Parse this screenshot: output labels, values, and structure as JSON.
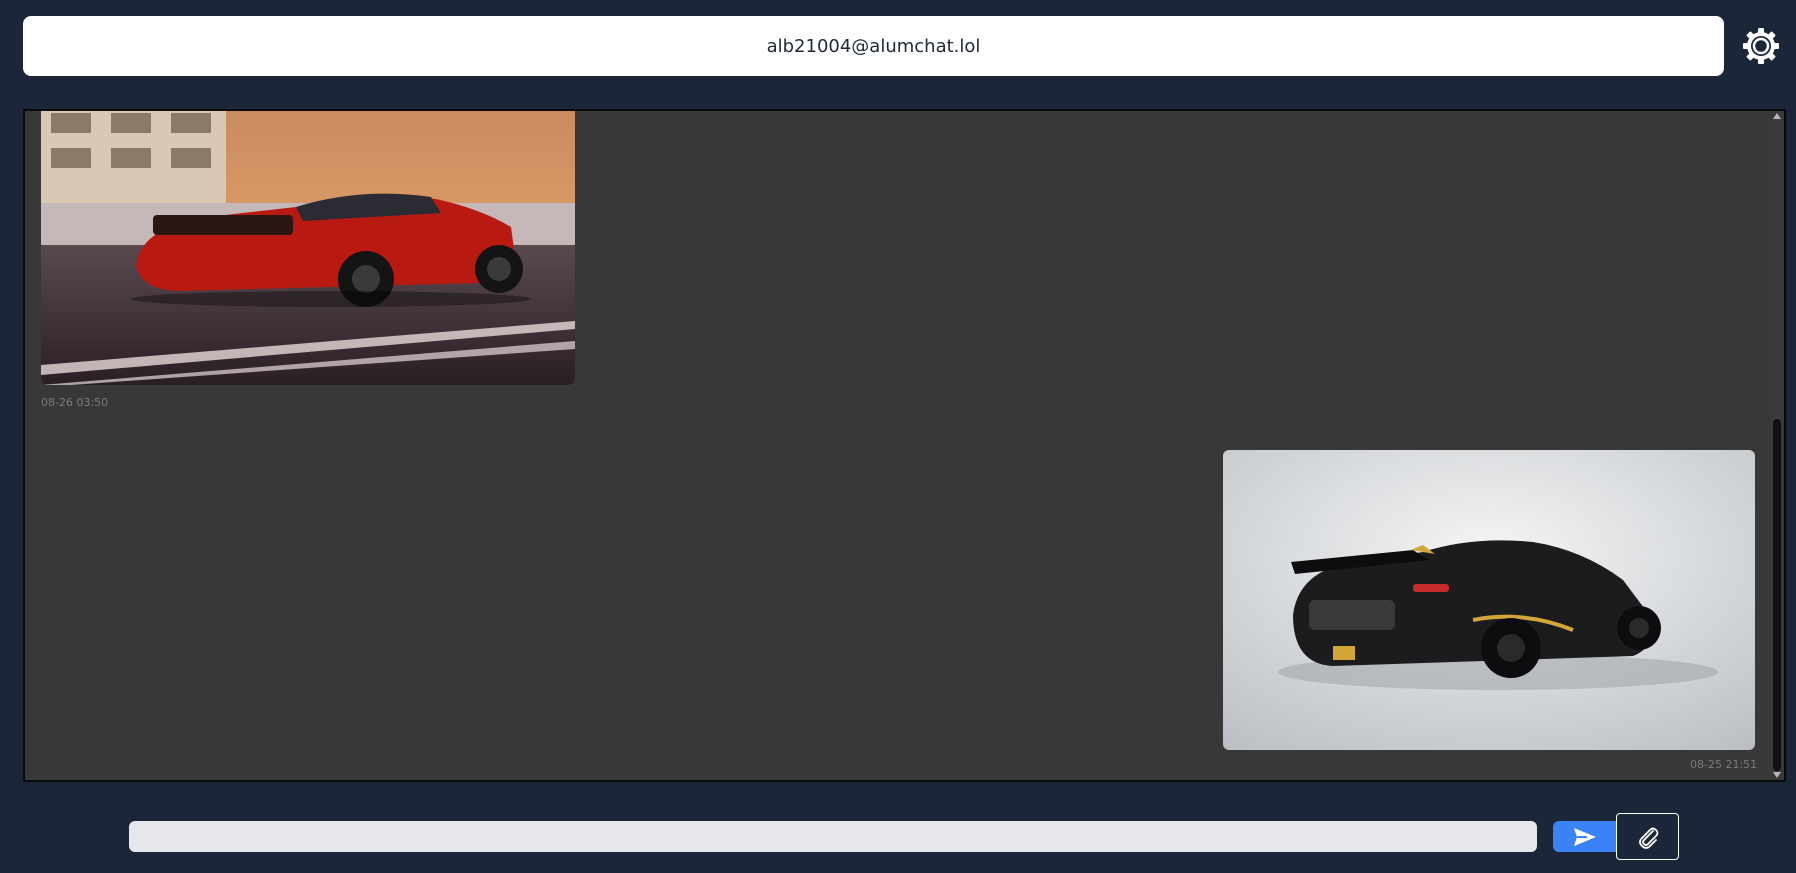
{
  "header": {
    "contact": "alb21004@alumchat.lol",
    "settings_icon": "gear-icon"
  },
  "messages": [
    {
      "type": "image",
      "image": "red-muscle-car-photo",
      "timestamp": "08-26 03:50",
      "direction": "received"
    },
    {
      "type": "image",
      "image": "black-gold-supercar-photo",
      "timestamp": "08-25 21:51",
      "direction": "sent"
    }
  ],
  "composer": {
    "value": "",
    "placeholder": "",
    "send_icon": "send-icon",
    "attach_icon": "paperclip-icon"
  },
  "colors": {
    "background": "#1b2638",
    "chat_background": "#383838",
    "send_button": "#3b82f6"
  }
}
